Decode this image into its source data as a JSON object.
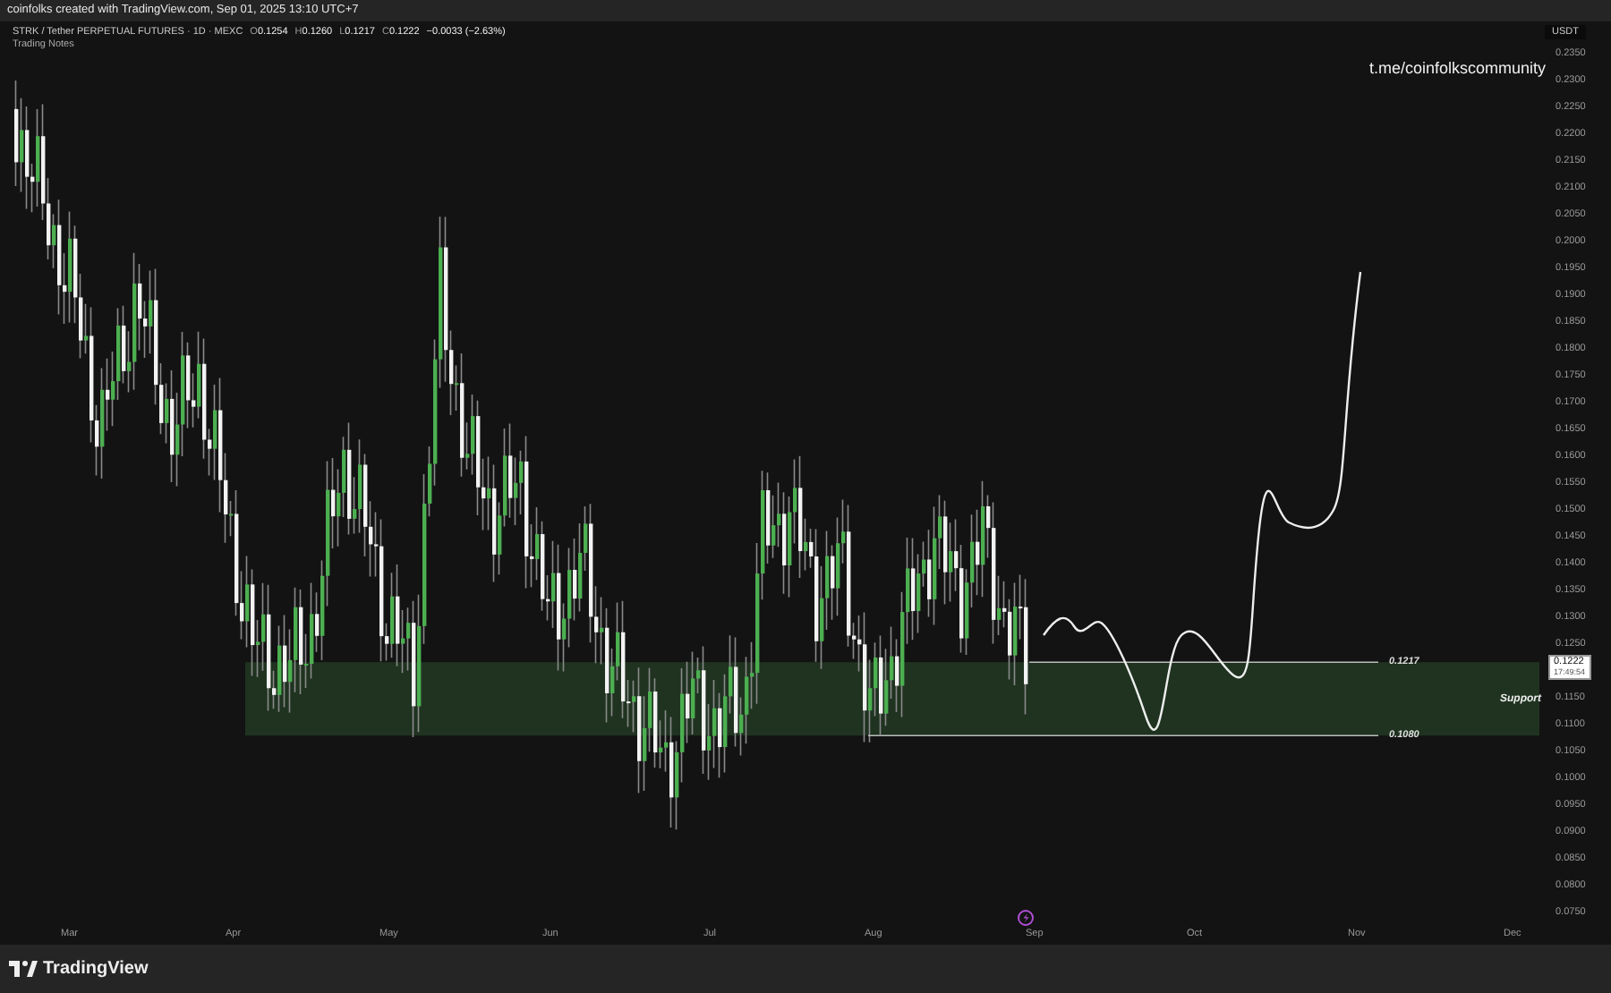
{
  "top_bar": {
    "text": "coinfolks created with TradingView.com, Sep 01, 2025 13:10 UTC+7"
  },
  "chart": {
    "symbol": "STRK / Tether PERPETUAL FUTURES · 1D · MEXC",
    "ohlc": [
      {
        "label": "O",
        "value": "0.1254"
      },
      {
        "label": "H",
        "value": "0.1260"
      },
      {
        "label": "L",
        "value": "0.1217"
      },
      {
        "label": "C",
        "value": "0.1222"
      }
    ],
    "change": "−0.0033 (−2.63%)",
    "indicator": "Trading Notes",
    "watermark": "t.me/coinfolkscommunity",
    "zone": {
      "label": "Support",
      "upper": "0.1217",
      "lower": "0.1080"
    }
  },
  "price_axis": {
    "unit": "USDT",
    "current_price": "0.1222",
    "countdown": "17:49:54",
    "ticks": [
      "0.2350",
      "0.2300",
      "0.2250",
      "0.2200",
      "0.2150",
      "0.2100",
      "0.2050",
      "0.2000",
      "0.1950",
      "0.1900",
      "0.1850",
      "0.1800",
      "0.1750",
      "0.1700",
      "0.1650",
      "0.1600",
      "0.1550",
      "0.1500",
      "0.1450",
      "0.1400",
      "0.1350",
      "0.1300",
      "0.1250",
      "0.1150",
      "0.1100",
      "0.1050",
      "0.1000",
      "0.0950",
      "0.0900",
      "0.0850",
      "0.0800",
      "0.0750"
    ]
  },
  "time_axis": {
    "months": [
      "Mar",
      "Apr",
      "May",
      "Jun",
      "Jul",
      "Aug",
      "Sep",
      "Oct",
      "Nov",
      "Dec"
    ]
  },
  "footer": {
    "brand": "TradingView"
  }
}
